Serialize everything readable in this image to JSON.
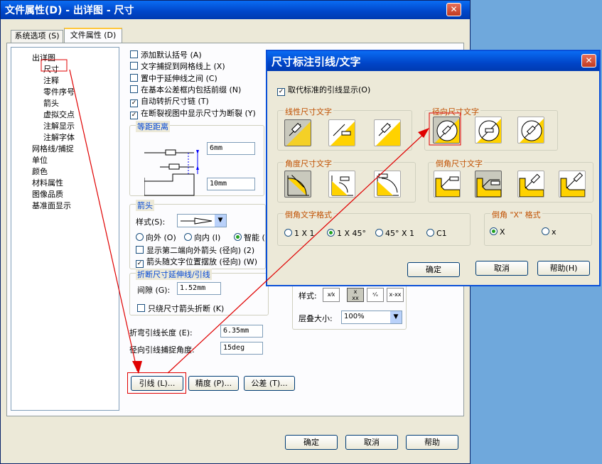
{
  "main": {
    "title": "文件属性(D) - 出详图 - 尺寸",
    "close": "✕",
    "tabs": [
      {
        "label": "系统选项 (S)"
      },
      {
        "label": "文件属性 (D)"
      }
    ],
    "tree": [
      "出详图",
      "尺寸",
      "注释",
      "零件序号",
      "箭头",
      "虚拟交点",
      "注解显示",
      "注解字体",
      "网格线/捕捉",
      "单位",
      "颜色",
      "材料属性",
      "图像品质",
      "基准面显示"
    ],
    "checks": [
      "添加默认括号 (A)",
      "文字捕捉到网格线上 (X)",
      "置中于延伸线之间 (C)",
      "在基本公差框内包括前缀 (N)",
      "自动转折尺寸链 (T)",
      "在断裂视图中显示尺寸为断裂 (Y)"
    ],
    "equal": {
      "title": "等距距离",
      "v1": "6mm",
      "v2": "10mm"
    },
    "arrows": {
      "title": "箭头",
      "style_label": "样式(S):",
      "r_out": "向外 (O)",
      "r_in": "向内 (I)",
      "r_smart": "智能 (",
      "c1": "显示第二端向外箭头 (径向) (2)",
      "c2": "箭头随文字位置摆放 (径向) (W)"
    },
    "broken": {
      "title": "折断尺寸延伸线/引线",
      "gap_label": "间隙 (G):",
      "gap": "1.52mm",
      "c": "只绕尺寸箭头折断 (K)"
    },
    "bent_label": "折弯引线长度 (E):",
    "bent": "6.35mm",
    "snap_label": "径向引线捕捉角度:",
    "snap": "15deg",
    "frac": {
      "style_label": "样式:",
      "stack_label": "层叠大小:",
      "stack": "100%"
    },
    "buttons": {
      "leader": "引线 (L)...",
      "precision": "精度 (P)...",
      "tolerance": "公差 (T)...",
      "ok": "确定",
      "cancel": "取消",
      "help": "帮助"
    }
  },
  "dlg": {
    "title": "尺寸标注引线/文字",
    "close": "✕",
    "override": "取代标准的引线显示(O)",
    "g_linear": "线性尺寸文字",
    "g_radial": "径向尺寸文字",
    "g_angle": "角度尺寸文字",
    "g_chamfer": "倒角尺寸文字",
    "g_chfmt": "倒角文字格式",
    "chfmt": [
      "1 X 1",
      "1 X 45°",
      "45° X 1",
      "C1"
    ],
    "g_x": "倒角 \"X\" 格式",
    "x": [
      "X",
      "x"
    ],
    "ok": "确定",
    "cancel": "取消",
    "help": "帮助(H)"
  },
  "colors": {
    "accent": "#0046d5",
    "red": "#e00000",
    "orange": "#c05000"
  }
}
